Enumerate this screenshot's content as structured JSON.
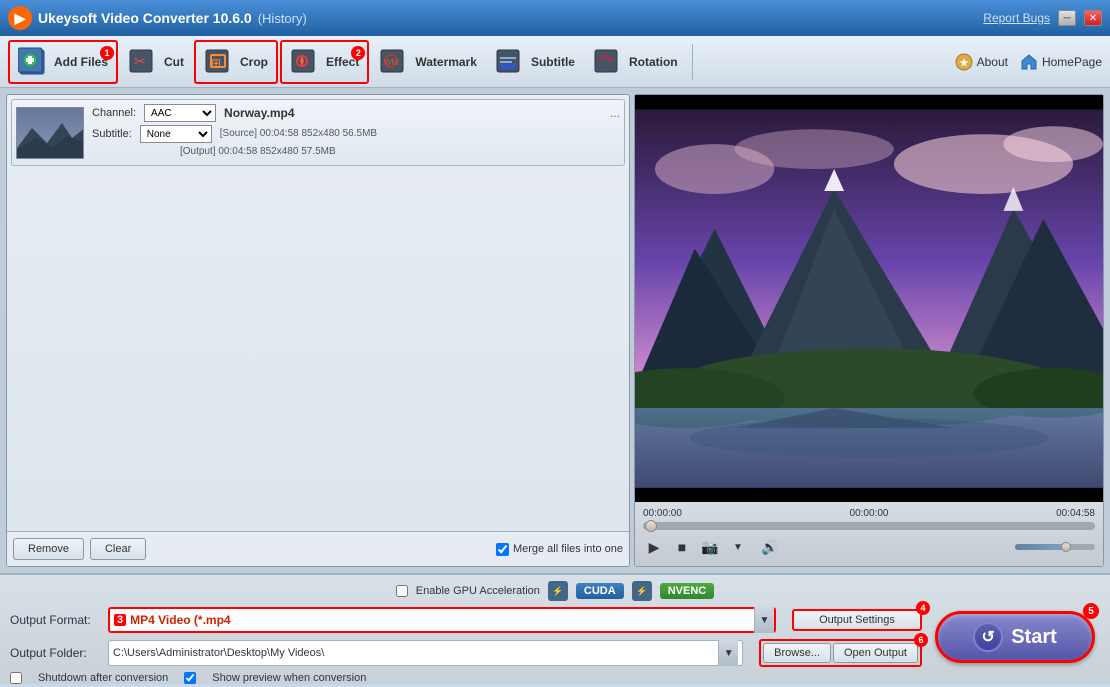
{
  "app": {
    "title": "Ukeysoft Video Converter 10.6.0",
    "history": "(History)",
    "report_bugs": "Report Bugs"
  },
  "toolbar": {
    "add_files": "Add Files",
    "cut": "Cut",
    "crop": "Crop",
    "effect": "Effect",
    "watermark": "Watermark",
    "subtitle": "Subtitle",
    "rotation": "Rotation",
    "about": "About",
    "homepage": "HomePage",
    "badge1": "1",
    "badge2": "2"
  },
  "file_list": {
    "file_name": "Norway.mp4",
    "channel_label": "Channel:",
    "channel_value": "AAC",
    "subtitle_label": "Subtitle:",
    "subtitle_value": "None",
    "source_info": "[Source]  00:04:58  852x480  56.5MB",
    "output_info": "[Output]  00:04:58  852x480  57.5MB",
    "more_icon": "..."
  },
  "buttons": {
    "remove": "Remove",
    "clear": "Clear",
    "merge_label": "Merge all files into one"
  },
  "video": {
    "time_start": "00:00:00",
    "time_mid": "00:00:00",
    "time_end": "00:04:58"
  },
  "bottom": {
    "gpu_label": "Enable GPU Acceleration",
    "cuda": "CUDA",
    "nvenc": "NVENC",
    "output_format_label": "Output Format:",
    "output_format_value": "MP4 Video (*.mp4",
    "output_settings": "Output Settings",
    "output_folder_label": "Output Folder:",
    "output_folder_value": "C:\\Users\\Administrator\\Desktop\\My Videos\\",
    "browse": "Browse...",
    "open_output": "Open Output",
    "shutdown": "Shutdown after conversion",
    "show_preview": "Show preview when conversion",
    "start": "Start",
    "badge3": "3",
    "badge4": "4",
    "badge5": "5",
    "badge6": "6"
  }
}
